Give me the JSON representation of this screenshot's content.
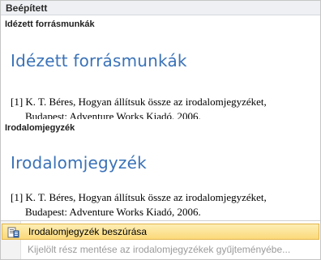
{
  "gallery": {
    "group_title": "Beépített",
    "sections": [
      {
        "label": "Idézett forrásmunkák",
        "preview_heading": "Idézett forrásmunkák",
        "entry_line1": "[1] K. T. Béres, Hogyan állítsuk össze az irodalomjegyzéket,",
        "entry_line2": "Budapest: Adventure Works Kiadó, 2006."
      },
      {
        "label": "Irodalomjegyzék",
        "preview_heading": "Irodalomjegyzék",
        "entry_line1": "[1] K. T. Béres, Hogyan állítsuk össze az irodalomjegyzéket,",
        "entry_line2": "Budapest: Adventure Works Kiadó, 2006."
      }
    ]
  },
  "menu": {
    "insert_bibliography": "Irodalomjegyzék beszúrása",
    "save_selection": "Kijelölt rész mentése az irodalomjegyzékek gyűjteményébe..."
  },
  "colors": {
    "heading_blue": "#3a72b8",
    "highlight": "#fbd97a"
  },
  "icons": {
    "insert": "insert-bibliography-icon",
    "save": "save-selection-icon"
  }
}
